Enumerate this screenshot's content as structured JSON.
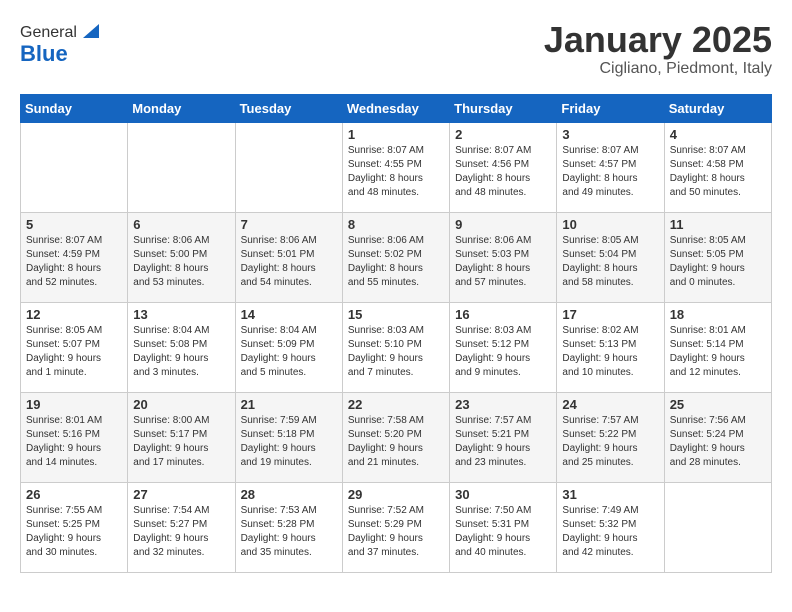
{
  "logo": {
    "general": "General",
    "blue": "Blue"
  },
  "title": "January 2025",
  "subtitle": "Cigliano, Piedmont, Italy",
  "headers": [
    "Sunday",
    "Monday",
    "Tuesday",
    "Wednesday",
    "Thursday",
    "Friday",
    "Saturday"
  ],
  "weeks": [
    [
      {
        "day": "",
        "info": ""
      },
      {
        "day": "",
        "info": ""
      },
      {
        "day": "",
        "info": ""
      },
      {
        "day": "1",
        "info": "Sunrise: 8:07 AM\nSunset: 4:55 PM\nDaylight: 8 hours\nand 48 minutes."
      },
      {
        "day": "2",
        "info": "Sunrise: 8:07 AM\nSunset: 4:56 PM\nDaylight: 8 hours\nand 48 minutes."
      },
      {
        "day": "3",
        "info": "Sunrise: 8:07 AM\nSunset: 4:57 PM\nDaylight: 8 hours\nand 49 minutes."
      },
      {
        "day": "4",
        "info": "Sunrise: 8:07 AM\nSunset: 4:58 PM\nDaylight: 8 hours\nand 50 minutes."
      }
    ],
    [
      {
        "day": "5",
        "info": "Sunrise: 8:07 AM\nSunset: 4:59 PM\nDaylight: 8 hours\nand 52 minutes."
      },
      {
        "day": "6",
        "info": "Sunrise: 8:06 AM\nSunset: 5:00 PM\nDaylight: 8 hours\nand 53 minutes."
      },
      {
        "day": "7",
        "info": "Sunrise: 8:06 AM\nSunset: 5:01 PM\nDaylight: 8 hours\nand 54 minutes."
      },
      {
        "day": "8",
        "info": "Sunrise: 8:06 AM\nSunset: 5:02 PM\nDaylight: 8 hours\nand 55 minutes."
      },
      {
        "day": "9",
        "info": "Sunrise: 8:06 AM\nSunset: 5:03 PM\nDaylight: 8 hours\nand 57 minutes."
      },
      {
        "day": "10",
        "info": "Sunrise: 8:05 AM\nSunset: 5:04 PM\nDaylight: 8 hours\nand 58 minutes."
      },
      {
        "day": "11",
        "info": "Sunrise: 8:05 AM\nSunset: 5:05 PM\nDaylight: 9 hours\nand 0 minutes."
      }
    ],
    [
      {
        "day": "12",
        "info": "Sunrise: 8:05 AM\nSunset: 5:07 PM\nDaylight: 9 hours\nand 1 minute."
      },
      {
        "day": "13",
        "info": "Sunrise: 8:04 AM\nSunset: 5:08 PM\nDaylight: 9 hours\nand 3 minutes."
      },
      {
        "day": "14",
        "info": "Sunrise: 8:04 AM\nSunset: 5:09 PM\nDaylight: 9 hours\nand 5 minutes."
      },
      {
        "day": "15",
        "info": "Sunrise: 8:03 AM\nSunset: 5:10 PM\nDaylight: 9 hours\nand 7 minutes."
      },
      {
        "day": "16",
        "info": "Sunrise: 8:03 AM\nSunset: 5:12 PM\nDaylight: 9 hours\nand 9 minutes."
      },
      {
        "day": "17",
        "info": "Sunrise: 8:02 AM\nSunset: 5:13 PM\nDaylight: 9 hours\nand 10 minutes."
      },
      {
        "day": "18",
        "info": "Sunrise: 8:01 AM\nSunset: 5:14 PM\nDaylight: 9 hours\nand 12 minutes."
      }
    ],
    [
      {
        "day": "19",
        "info": "Sunrise: 8:01 AM\nSunset: 5:16 PM\nDaylight: 9 hours\nand 14 minutes."
      },
      {
        "day": "20",
        "info": "Sunrise: 8:00 AM\nSunset: 5:17 PM\nDaylight: 9 hours\nand 17 minutes."
      },
      {
        "day": "21",
        "info": "Sunrise: 7:59 AM\nSunset: 5:18 PM\nDaylight: 9 hours\nand 19 minutes."
      },
      {
        "day": "22",
        "info": "Sunrise: 7:58 AM\nSunset: 5:20 PM\nDaylight: 9 hours\nand 21 minutes."
      },
      {
        "day": "23",
        "info": "Sunrise: 7:57 AM\nSunset: 5:21 PM\nDaylight: 9 hours\nand 23 minutes."
      },
      {
        "day": "24",
        "info": "Sunrise: 7:57 AM\nSunset: 5:22 PM\nDaylight: 9 hours\nand 25 minutes."
      },
      {
        "day": "25",
        "info": "Sunrise: 7:56 AM\nSunset: 5:24 PM\nDaylight: 9 hours\nand 28 minutes."
      }
    ],
    [
      {
        "day": "26",
        "info": "Sunrise: 7:55 AM\nSunset: 5:25 PM\nDaylight: 9 hours\nand 30 minutes."
      },
      {
        "day": "27",
        "info": "Sunrise: 7:54 AM\nSunset: 5:27 PM\nDaylight: 9 hours\nand 32 minutes."
      },
      {
        "day": "28",
        "info": "Sunrise: 7:53 AM\nSunset: 5:28 PM\nDaylight: 9 hours\nand 35 minutes."
      },
      {
        "day": "29",
        "info": "Sunrise: 7:52 AM\nSunset: 5:29 PM\nDaylight: 9 hours\nand 37 minutes."
      },
      {
        "day": "30",
        "info": "Sunrise: 7:50 AM\nSunset: 5:31 PM\nDaylight: 9 hours\nand 40 minutes."
      },
      {
        "day": "31",
        "info": "Sunrise: 7:49 AM\nSunset: 5:32 PM\nDaylight: 9 hours\nand 42 minutes."
      },
      {
        "day": "",
        "info": ""
      }
    ]
  ]
}
